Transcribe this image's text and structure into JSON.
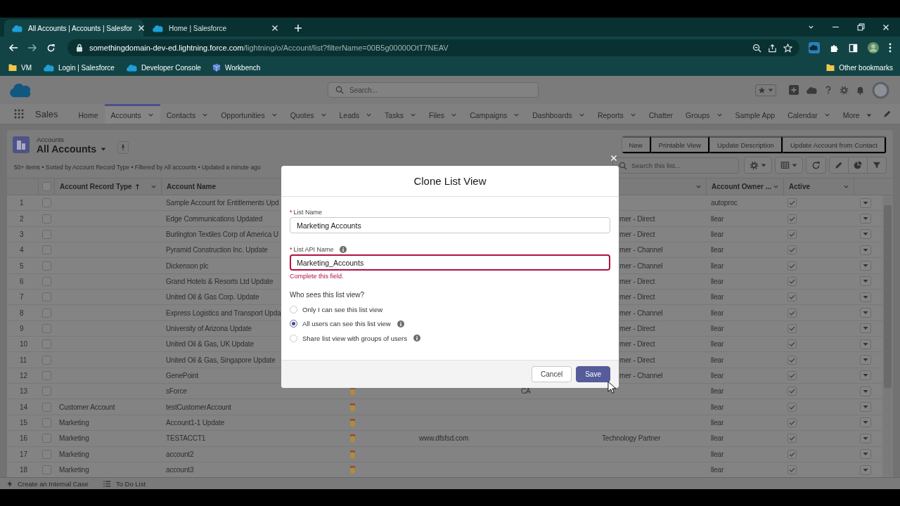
{
  "browser": {
    "tabs": [
      {
        "title": "All Accounts | Accounts | Salesfor",
        "selected": true
      },
      {
        "title": "Home | Salesforce",
        "selected": false
      }
    ],
    "url": {
      "host": "somethingdomain-dev-ed.lightning.force.com",
      "path": "/lightning/o/Account/list?filterName=00B5g00000OtT7NEAV"
    },
    "bookmarks": [
      {
        "label": "VM",
        "kind": "folder"
      },
      {
        "label": "Login | Salesforce",
        "kind": "cloud"
      },
      {
        "label": "Developer Console",
        "kind": "cloud"
      },
      {
        "label": "Workbench",
        "kind": "cube"
      }
    ],
    "other_bookmarks": {
      "label": "Other bookmarks",
      "kind": "folder"
    }
  },
  "app": {
    "search_placeholder": "Search...",
    "name": "Sales",
    "nav": [
      {
        "label": "Home",
        "kind": "plain",
        "selected": false
      },
      {
        "label": "Accounts",
        "kind": "chevron",
        "selected": true
      },
      {
        "label": "Contacts",
        "kind": "chevron",
        "selected": false
      },
      {
        "label": "Opportunities",
        "kind": "chevron",
        "selected": false
      },
      {
        "label": "Quotes",
        "kind": "chevron",
        "selected": false
      },
      {
        "label": "Leads",
        "kind": "chevron",
        "selected": false
      },
      {
        "label": "Tasks",
        "kind": "chevron",
        "selected": false
      },
      {
        "label": "Files",
        "kind": "chevron",
        "selected": false
      },
      {
        "label": "Campaigns",
        "kind": "chevron",
        "selected": false
      },
      {
        "label": "Dashboards",
        "kind": "chevron",
        "selected": false
      },
      {
        "label": "Reports",
        "kind": "chevron",
        "selected": false
      },
      {
        "label": "Chatter",
        "kind": "plain",
        "selected": false
      },
      {
        "label": "Groups",
        "kind": "chevron",
        "selected": false
      },
      {
        "label": "Sample App",
        "kind": "plain",
        "selected": false
      },
      {
        "label": "Calendar",
        "kind": "chevron",
        "selected": false
      },
      {
        "label": "More",
        "kind": "caret",
        "selected": false
      }
    ]
  },
  "list_view": {
    "object": "Accounts",
    "title": "All Accounts",
    "actions": [
      "New",
      "Printable View",
      "Update Description",
      "Update Account from Contact"
    ],
    "summary": "50+ items • Sorted by Account Record Type • Filtered by All accounts • Updated a minute ago",
    "search_placeholder": "Search this list...",
    "all_selected": false,
    "columns": [
      {
        "label": "Account Record Type",
        "sorted": true,
        "menu": true
      },
      {
        "label": "Account Name",
        "sorted": false,
        "menu": false
      },
      {
        "menu": true
      },
      {
        "label": "Account Owner ...",
        "sorted": false,
        "menu": true
      },
      {
        "label": "Active",
        "sorted": false,
        "menu": true
      }
    ],
    "rows": [
      {
        "number": "1",
        "name": "Sample Account for Entitlements Upd",
        "owner": "autoproc",
        "covered": true,
        "badge": false,
        "selected": false,
        "active": true
      },
      {
        "number": "2",
        "name": "Edge Communications Updated",
        "type": "mer - Direct",
        "owner": "llear",
        "covered": true,
        "badge": false,
        "selected": false,
        "active": true
      },
      {
        "number": "3",
        "name": "Burlington Textiles Corp of America U",
        "type": "mer - Direct",
        "owner": "llear",
        "covered": true,
        "badge": false,
        "selected": false,
        "active": true
      },
      {
        "number": "4",
        "name": "Pyramid Construction Inc. Update",
        "type": "mer - Channel",
        "owner": "llear",
        "covered": true,
        "badge": false,
        "selected": false,
        "active": true
      },
      {
        "number": "5",
        "name": "Dickenson plc",
        "type": "mer - Channel",
        "owner": "llear",
        "covered": true,
        "badge": false,
        "selected": false,
        "active": true
      },
      {
        "number": "6",
        "name": "Grand Hotels & Resorts Ltd Update",
        "type": "mer - Direct",
        "owner": "llear",
        "covered": true,
        "badge": false,
        "selected": false,
        "active": true
      },
      {
        "number": "7",
        "name": "United Oil & Gas Corp. Update",
        "type": "mer - Direct",
        "owner": "llear",
        "covered": true,
        "badge": false,
        "selected": false,
        "active": true
      },
      {
        "number": "8",
        "name": "Express Logistics and Transport Upda",
        "type": "mer - Channel",
        "owner": "llear",
        "covered": true,
        "badge": false,
        "selected": false,
        "active": true
      },
      {
        "number": "9",
        "name": "University of Arizona Update",
        "type": "mer - Direct",
        "owner": "llear",
        "covered": true,
        "badge": false,
        "selected": false,
        "active": true
      },
      {
        "number": "10",
        "name": "United Oil & Gas, UK Update",
        "type": "mer - Direct",
        "owner": "llear",
        "covered": true,
        "badge": false,
        "selected": false,
        "active": true
      },
      {
        "number": "11",
        "name": "United Oil & Gas, Singapore Update",
        "type": "mer - Direct",
        "owner": "llear",
        "covered": true,
        "badge": false,
        "selected": false,
        "active": true
      },
      {
        "number": "12",
        "name": "GenePoint",
        "type": "mer - Channel",
        "owner": "llear",
        "covered": true,
        "badge": false,
        "selected": false,
        "active": true
      },
      {
        "number": "13",
        "name": "sForce",
        "state": "CA",
        "owner": "llear",
        "covered": false,
        "badge": true,
        "selected": false,
        "active": true
      },
      {
        "number": "14",
        "record_type": "Customer Account",
        "name": "testCustomerAccount",
        "owner": "llear",
        "covered": false,
        "badge": true,
        "selected": false,
        "active": true
      },
      {
        "number": "15",
        "record_type": "Marketing",
        "name": "Account1-1 Update",
        "owner": "llear",
        "covered": false,
        "badge": true,
        "selected": false,
        "active": true
      },
      {
        "number": "16",
        "record_type": "Marketing",
        "name": "TESTACCT1",
        "website": "www.dfsfsd.com",
        "type": "Technology Partner",
        "owner": "llear",
        "covered": false,
        "badge": true,
        "selected": false,
        "active": true
      },
      {
        "number": "17",
        "record_type": "Marketing",
        "name": "account2",
        "owner": "llear",
        "covered": false,
        "badge": true,
        "selected": false,
        "active": true
      },
      {
        "number": "18",
        "record_type": "Marketing",
        "name": "account3",
        "owner": "llear",
        "covered": false,
        "badge": true,
        "selected": false,
        "active": true
      }
    ]
  },
  "modal": {
    "title": "Clone List View",
    "fields": [
      {
        "label": "List Name",
        "required": "*",
        "value": "Marketing Accounts",
        "info": false,
        "invalid": false
      },
      {
        "label": "List API Name",
        "required": "*",
        "value": "Marketing_Accounts",
        "info": true,
        "invalid": true,
        "error": "Complete this field."
      }
    ],
    "question": "Who sees this list view?",
    "options": [
      {
        "label": "Only I can see this list view",
        "selected": false,
        "info": false
      },
      {
        "label": "All users can see this list view",
        "selected": true,
        "info": true
      },
      {
        "label": "Share list view with groups of users",
        "selected": false,
        "info": true
      }
    ],
    "buttons": [
      {
        "label": "Cancel",
        "kind": "neutral"
      },
      {
        "label": "Save",
        "kind": "brand"
      }
    ]
  },
  "utility_bar": [
    {
      "label": "Create an Internal Case",
      "kind": "bolt"
    },
    {
      "label": "To Do List",
      "kind": "list"
    }
  ]
}
